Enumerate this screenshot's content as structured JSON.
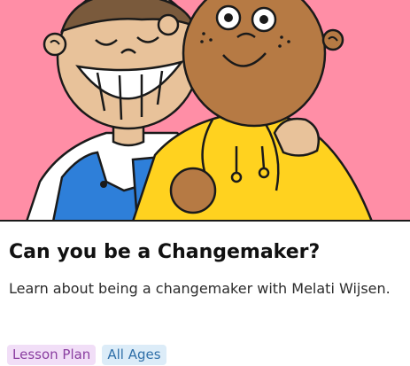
{
  "card": {
    "title": "Can you be a Changemaker?",
    "description": "Learn about being a changemaker with Melati Wijsen.",
    "tags": [
      {
        "label": "Lesson Plan"
      },
      {
        "label": "All Ages"
      }
    ]
  },
  "colors": {
    "hero_background": "#ff8ea6",
    "skin_light": "#e8c29a",
    "skin_dark": "#b67a44",
    "hair": "#7a5a3c",
    "overalls": "#2e7fd9",
    "jacket": "#ffd21f",
    "tag_lesson_bg": "#f1def7",
    "tag_lesson_text": "#8a3ea0",
    "tag_ages_bg": "#dcecf8",
    "tag_ages_text": "#2f6fa8"
  }
}
